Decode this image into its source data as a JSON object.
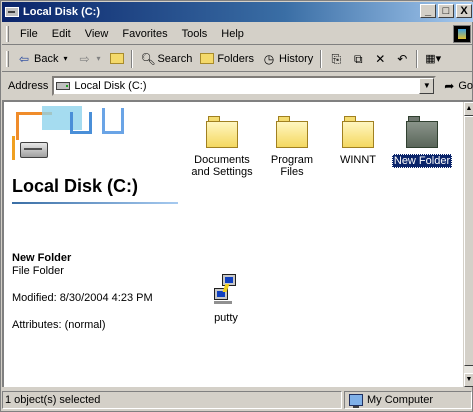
{
  "window": {
    "title": "Local Disk (C:)",
    "controls": {
      "minimize": "_",
      "maximize": "□",
      "close": "X"
    }
  },
  "menu": [
    "File",
    "Edit",
    "View",
    "Favorites",
    "Tools",
    "Help"
  ],
  "toolbar": {
    "back_label": "Back",
    "search_label": "Search",
    "folders_label": "Folders",
    "history_label": "History",
    "views_glyph": "▦▾"
  },
  "address": {
    "label": "Address",
    "value": "Local Disk (C:)",
    "go_label": "Go"
  },
  "leftpane": {
    "disk_title": "Local Disk (C:)",
    "selected_name": "New Folder",
    "selected_type": "File Folder",
    "modified": "Modified: 8/30/2004 4:23 PM",
    "attributes": "Attributes: (normal)"
  },
  "items": [
    {
      "label_line1": "Documents",
      "label_line2": "and Settings",
      "icon": "folder-icon",
      "selected": false
    },
    {
      "label_line1": "Program Files",
      "label_line2": "",
      "icon": "folder-icon",
      "selected": false
    },
    {
      "label_line1": "WINNT",
      "label_line2": "",
      "icon": "folder-icon",
      "selected": false
    },
    {
      "label_line1": "New Folder",
      "label_line2": "",
      "icon": "folder-icon",
      "selected": true
    },
    {
      "label_line1": "putty",
      "label_line2": "",
      "icon": "putty-icon",
      "selected": false
    }
  ],
  "statusbar": {
    "selection": "1 object(s) selected",
    "zone": "My Computer"
  },
  "colors": {
    "title_gradient_start": "#0a246a",
    "title_gradient_end": "#a6caf0",
    "selection": "#0a246a",
    "chrome": "#d4d0c8"
  }
}
